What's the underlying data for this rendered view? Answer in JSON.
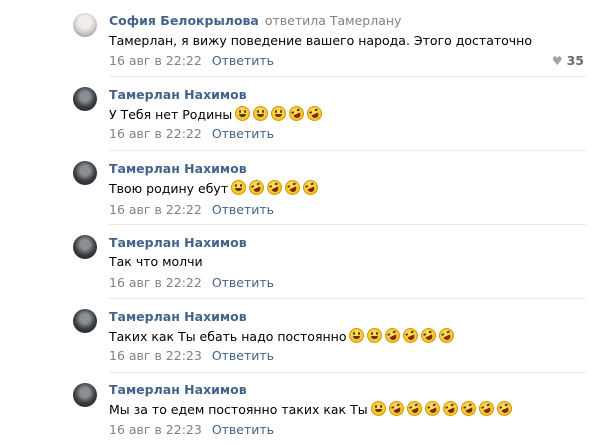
{
  "comments": [
    {
      "author": "София Белокрылова",
      "reply_to": "ответила Тамерлану",
      "text": "Тамерлан, я вижу поведение вашего народа. Этого достаточно",
      "emojis": [],
      "time": "16 авг в 22:22",
      "reply_label": "Ответить",
      "likes": "35",
      "avatar": "sofia"
    },
    {
      "author": "Тамерлан Нахимов",
      "text": "У Тебя нет Родины",
      "emojis": [
        "smile",
        "smile",
        "smile",
        "rofl",
        "rofl"
      ],
      "time": "16 авг в 22:22",
      "reply_label": "Ответить",
      "avatar": "tam"
    },
    {
      "author": "Тамерлан Нахимов",
      "text": "Твою родину ебут",
      "emojis": [
        "smile",
        "rofl",
        "rofl",
        "rofl",
        "rofl"
      ],
      "time": "16 авг в 22:22",
      "reply_label": "Ответить",
      "avatar": "tam"
    },
    {
      "author": "Тамерлан Нахимов",
      "text": "Так что молчи",
      "emojis": [],
      "time": "16 авг в 22:22",
      "reply_label": "Ответить",
      "avatar": "tam"
    },
    {
      "author": "Тамерлан Нахимов",
      "text": "Таких как Ты ебать надо постоянно",
      "emojis": [
        "smile",
        "smile",
        "rofl",
        "rofl",
        "rofl",
        "rofl"
      ],
      "time": "16 авг в 22:23",
      "reply_label": "Ответить",
      "avatar": "tam"
    },
    {
      "author": "Тамерлан Нахимов",
      "text": "Мы за то едем постоянно таких как Ты",
      "emojis": [
        "smile",
        "rofl",
        "rofl",
        "rofl",
        "rofl",
        "rofl",
        "rofl",
        "rofl"
      ],
      "time": "16 авг в 22:23",
      "reply_label": "Ответить",
      "avatar": "tam"
    }
  ],
  "colors": {
    "link": "#42648b",
    "meta": "#828282",
    "divider": "#e7e8ec"
  },
  "icons": {
    "like": "heart-icon",
    "emoji_smile": "smile-emoji-icon",
    "emoji_rofl": "rofl-emoji-icon"
  }
}
